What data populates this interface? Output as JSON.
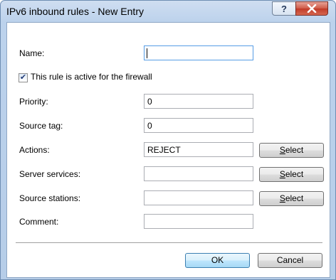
{
  "window": {
    "title": "IPv6 inbound rules - New Entry",
    "help_glyph": "?",
    "close_icon": "close-icon"
  },
  "form": {
    "name_label": "Name:",
    "name_value": "",
    "active_checkbox_label": "This rule is active for the firewall",
    "active_checked": true,
    "priority_label": "Priority:",
    "priority_value": "0",
    "source_tag_label": "Source tag:",
    "source_tag_value": "0",
    "actions_label": "Actions:",
    "actions_value": "REJECT",
    "server_services_label": "Server services:",
    "server_services_value": "",
    "source_stations_label": "Source stations:",
    "source_stations_value": "",
    "comment_label": "Comment:",
    "comment_value": "",
    "select_label_prefix": "S",
    "select_label_rest": "elect"
  },
  "buttons": {
    "ok": "OK",
    "cancel": "Cancel"
  },
  "colors": {
    "title_bar": "#bcd2ec",
    "close_button": "#c13a28",
    "default_button_border": "#3c7fb1"
  }
}
